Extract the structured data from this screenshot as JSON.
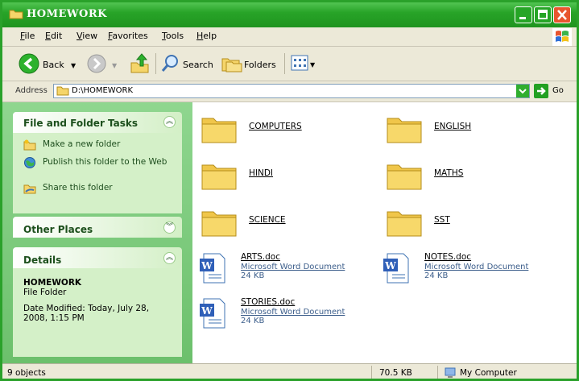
{
  "window": {
    "title": "HOMEWORK"
  },
  "menu": [
    "File",
    "Edit",
    "View",
    "Favorites",
    "Tools",
    "Help"
  ],
  "toolbar": {
    "back_label": "Back",
    "search_label": "Search",
    "folders_label": "Folders"
  },
  "address": {
    "label": "Address",
    "value": "D:\\HOMEWORK",
    "go_label": "Go"
  },
  "sidebar": {
    "tasks": {
      "title": "File and Folder Tasks",
      "items": [
        "Make a new folder",
        "Publish this folder to the Web",
        "Share this folder"
      ]
    },
    "other_places": {
      "title": "Other Places"
    },
    "details": {
      "title": "Details",
      "name": "HOMEWORK",
      "type": "File Folder",
      "modified": "Date Modified: Today, July 28, 2008, 1:15 PM"
    }
  },
  "folders": [
    "COMPUTERS",
    "ENGLISH",
    "HINDI",
    "MATHS",
    "SCIENCE",
    "SST"
  ],
  "files": [
    {
      "name": "ARTS.doc",
      "type": "Microsoft Word Document",
      "size": "24 KB"
    },
    {
      "name": "NOTES.doc",
      "type": "Microsoft Word Document",
      "size": "24 KB"
    },
    {
      "name": "STORIES.doc",
      "type": "Microsoft Word Document",
      "size": "24 KB"
    }
  ],
  "status": {
    "objects": "9 objects",
    "size": "70.5 KB",
    "location": "My Computer"
  },
  "colors": {
    "titlebar": "#28a428",
    "sidebar": "#7fcf7f",
    "close": "#e8552e"
  }
}
